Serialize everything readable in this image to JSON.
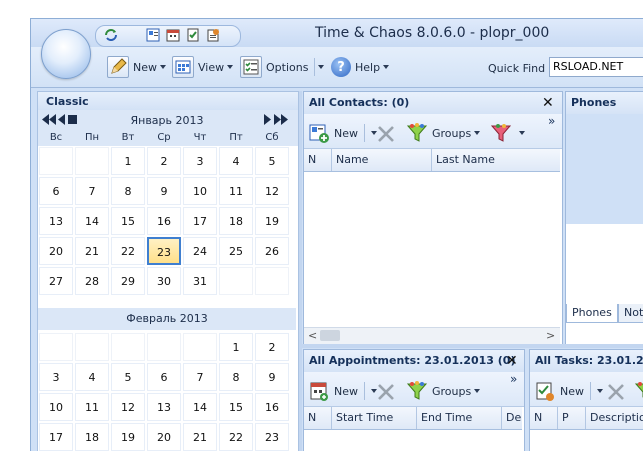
{
  "window": {
    "title": "Time & Chaos 8.0.6.0 - plopr_000"
  },
  "toolbar": {
    "new_label": "New",
    "view_label": "View",
    "options_label": "Options",
    "help_label": "Help",
    "quickfind_label": "Quick Find",
    "quickfind_value": "RSLOAD.NET"
  },
  "calendar": {
    "header": "Classic",
    "month1": "Январь 2013",
    "weekdays": [
      "Вс",
      "Пн",
      "Вт",
      "Ср",
      "Чт",
      "Пт",
      "Сб"
    ],
    "month1_rows": [
      [
        "",
        "",
        "1",
        "2",
        "3",
        "4",
        "5"
      ],
      [
        "6",
        "7",
        "8",
        "9",
        "10",
        "11",
        "12"
      ],
      [
        "13",
        "14",
        "15",
        "16",
        "17",
        "18",
        "19"
      ],
      [
        "20",
        "21",
        "22",
        "23",
        "24",
        "25",
        "26"
      ],
      [
        "27",
        "28",
        "29",
        "30",
        "31",
        "",
        ""
      ]
    ],
    "selected_day": "23",
    "month2": "Февраль 2013",
    "month2_rows": [
      [
        "",
        "",
        "",
        "",
        "",
        "1",
        "2"
      ],
      [
        "3",
        "4",
        "5",
        "6",
        "7",
        "8",
        "9"
      ],
      [
        "10",
        "11",
        "12",
        "13",
        "14",
        "15",
        "16"
      ],
      [
        "17",
        "18",
        "19",
        "20",
        "21",
        "22",
        "23"
      ]
    ]
  },
  "contacts": {
    "title": "All Contacts:  (0)",
    "new_label": "New",
    "groups_label": "Groups",
    "columns": [
      "N",
      "Name",
      "Last Name"
    ]
  },
  "phones": {
    "title": "Phones",
    "tabs": [
      "Phones",
      "Not"
    ]
  },
  "appointments": {
    "title": "All Appointments: 23.01.2013  (0)",
    "new_label": "New",
    "groups_label": "Groups",
    "columns": [
      "N",
      "Start Time",
      "End Time",
      "De"
    ]
  },
  "tasks": {
    "title": "All Tasks: 23.01.2013",
    "new_label": "New",
    "columns": [
      "N",
      "P",
      "Descriptio"
    ]
  },
  "icons": {
    "close": "close-icon",
    "overflow": "»"
  }
}
